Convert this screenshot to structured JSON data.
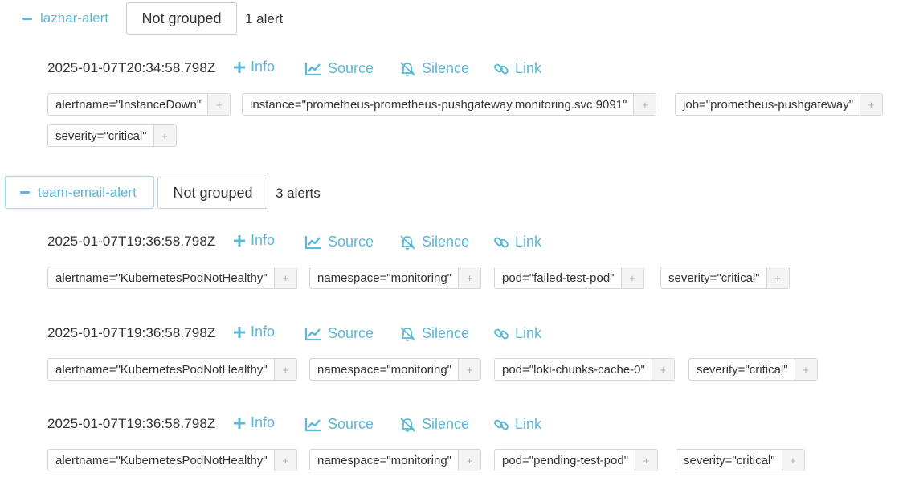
{
  "groups": [
    {
      "name": "lazhar-alert",
      "grouping_label": "Not grouped",
      "count_text": "1 alert",
      "alerts": [
        {
          "timestamp": "2025-01-07T20:34:58.798Z",
          "labels": [
            "alertname=\"InstanceDown\"",
            "instance=\"prometheus-prometheus-pushgateway.monitoring.svc:9091\"",
            "job=\"prometheus-pushgateway\"",
            "severity=\"critical\""
          ]
        }
      ]
    },
    {
      "name": "team-email-alert",
      "grouping_label": "Not grouped",
      "count_text": "3 alerts",
      "alerts": [
        {
          "timestamp": "2025-01-07T19:36:58.798Z",
          "labels": [
            "alertname=\"KubernetesPodNotHealthy\"",
            "namespace=\"monitoring\"",
            "pod=\"failed-test-pod\"",
            "severity=\"critical\""
          ]
        },
        {
          "timestamp": "2025-01-07T19:36:58.798Z",
          "labels": [
            "alertname=\"KubernetesPodNotHealthy\"",
            "namespace=\"monitoring\"",
            "pod=\"loki-chunks-cache-0\"",
            "severity=\"critical\""
          ]
        },
        {
          "timestamp": "2025-01-07T19:36:58.798Z",
          "labels": [
            "alertname=\"KubernetesPodNotHealthy\"",
            "namespace=\"monitoring\"",
            "pod=\"pending-test-pod\"",
            "severity=\"critical\""
          ]
        }
      ]
    }
  ],
  "actions": {
    "info": "Info",
    "source": "Source",
    "silence": "Silence",
    "link": "Link",
    "add_label_symbol": "+"
  },
  "icons": {
    "info": "plus-icon",
    "source": "line-chart-icon",
    "silence": "bell-slash-icon",
    "link": "link-icon",
    "collapse": "minus-icon"
  },
  "colors": {
    "accent": "#5bb8d6",
    "border": "#d6d6d6",
    "text": "#333333"
  }
}
